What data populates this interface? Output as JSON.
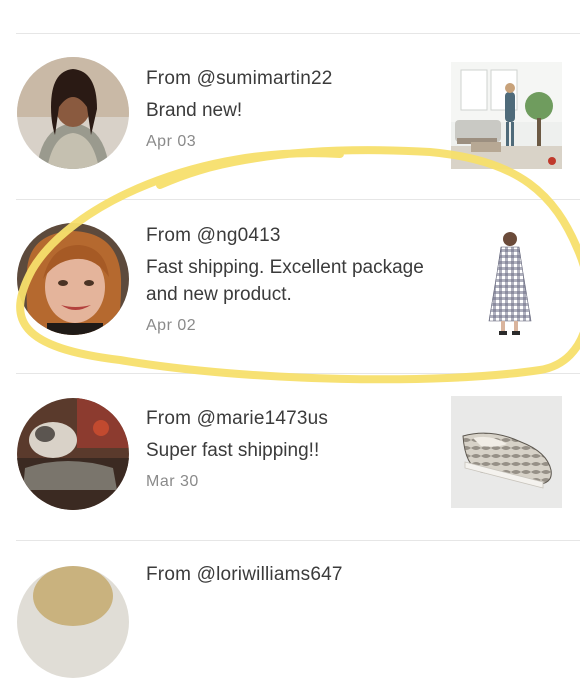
{
  "reviews": [
    {
      "from": "From @sumimartin22",
      "message": "Brand new!",
      "date": "Apr 03",
      "avatar_icon": "user-avatar-photo",
      "thumb_icon": "living-room-product-photo"
    },
    {
      "from": "From @ng0413",
      "message": "Fast shipping. Excellent package and new product.",
      "date": "Apr 02",
      "avatar_icon": "user-avatar-photo",
      "thumb_icon": "gingham-dress-product-photo"
    },
    {
      "from": "From @marie1473us",
      "message": "Super fast shipping!!",
      "date": "Mar 30",
      "avatar_icon": "user-avatar-photo",
      "thumb_icon": "snakeskin-sneaker-product-photo"
    },
    {
      "from": "From @loriwilliams647",
      "message": "",
      "date": "",
      "avatar_icon": "user-avatar-photo",
      "thumb_icon": ""
    }
  ],
  "colors": {
    "highlight": "#f7df6b",
    "text": "#3b3b3b",
    "date": "#8a8a8a",
    "divider": "#e6e6e6"
  }
}
